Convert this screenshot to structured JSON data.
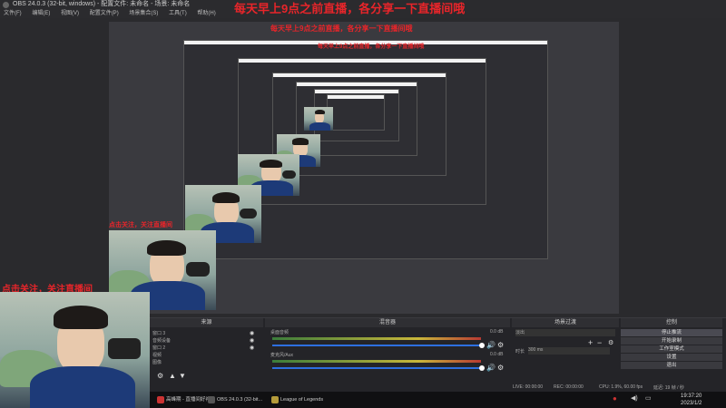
{
  "window": {
    "title": "OBS 24.0.3 (32-bit, windows) - 配置文件: 未命名 - 场景: 未命名"
  },
  "menu": [
    "文件(F)",
    "编辑(E)",
    "视图(V)",
    "配置文件(P)",
    "场景集合(S)",
    "工具(T)",
    "帮助(H)"
  ],
  "overlay": {
    "banner": "每天早上9点之前直播，各分享一下直播间哦",
    "cam_caption": "点击关注，关注直播间"
  },
  "docks": {
    "sources_title": "来源",
    "mixer_title": "混音器",
    "transitions_title": "场景过渡",
    "controls_title": "控制"
  },
  "sources": [
    "窗口 3",
    "音频设备",
    "窗口 2",
    "视频",
    "图像"
  ],
  "mixer": {
    "tracks": [
      {
        "name": "桌面音频",
        "db": "0.0 dB"
      },
      {
        "name": "麦克风/Aux",
        "db": "0.0 dB"
      }
    ]
  },
  "transitions": {
    "type": "淡出",
    "duration_label": "时长",
    "duration": "300 ms"
  },
  "controls": [
    "停止推流",
    "开始录制",
    "工作室模式",
    "设置",
    "退出"
  ],
  "status": {
    "live": "LIVE: 00:00:00",
    "rec": "REC: 00:00:00",
    "cpu": "CPU: 1.9%, 60.00 fps",
    "dropped": "延迟: 19 帧 / 秒"
  },
  "taskbar": {
    "items": [
      {
        "label": "高峰期 - 直播间好礼",
        "color": "#c33"
      },
      {
        "label": "OBS 24.0.3 (32-bit...",
        "color": "#555"
      },
      {
        "label": "League of Legends",
        "color": "#b49b3a"
      }
    ],
    "time": "19:37:20",
    "date": "2023/1/2"
  }
}
